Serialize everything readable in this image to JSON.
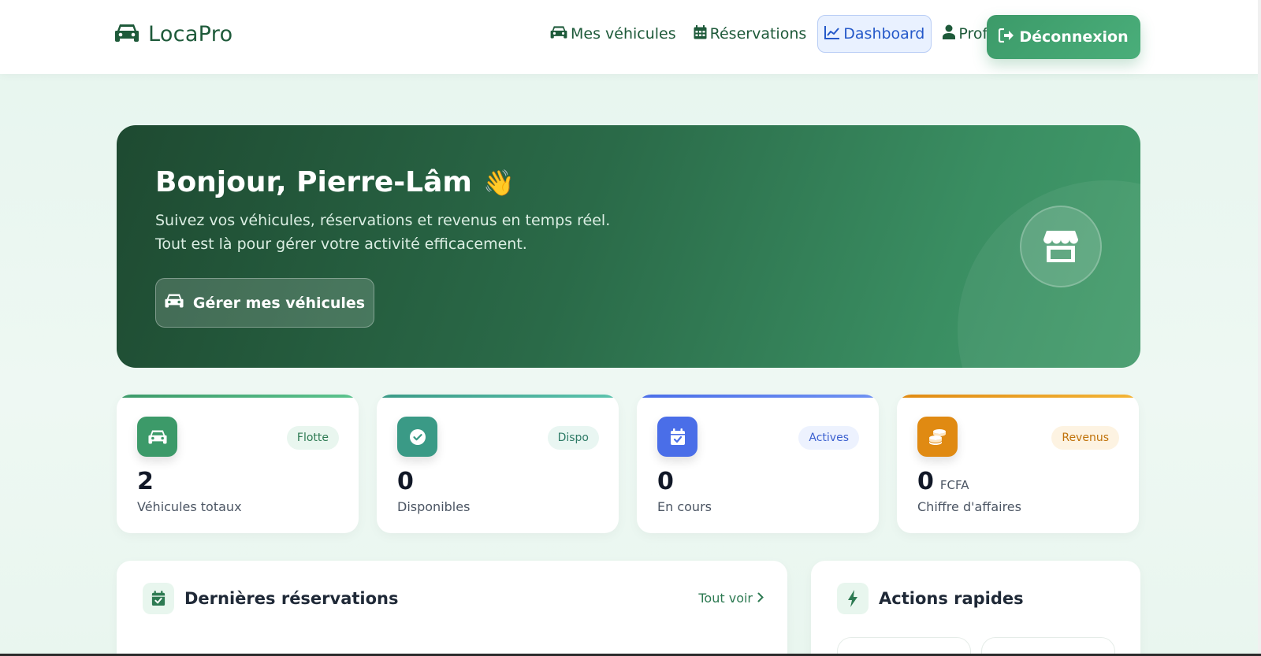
{
  "header": {
    "brand": "LocaPro",
    "nav": [
      {
        "label": "Mes véhicules",
        "icon": "car-icon"
      },
      {
        "label": "Réservations",
        "icon": "calendar-icon"
      },
      {
        "label": "Dashboard",
        "icon": "chart-line-icon",
        "active": true
      },
      {
        "label": "Profil",
        "icon": "user-icon"
      }
    ],
    "logout_label": "Déconnexion"
  },
  "hero": {
    "title": "Bonjour, Pierre-Lâm",
    "wave_emoji": "👋",
    "subtitle": "Suivez vos véhicules, réservations et revenus en temps réel. Tout est là pour gérer votre activité efficacement.",
    "button_label": "Gérer mes véhicules",
    "icon": "store-icon"
  },
  "stats": [
    {
      "tag": "Flotte",
      "value": "2",
      "unit": "",
      "label": "Véhicules totaux",
      "icon": "car-icon",
      "color": "#3c9a69"
    },
    {
      "tag": "Dispo",
      "value": "0",
      "unit": "",
      "label": "Disponibles",
      "icon": "check-circle-icon",
      "color": "#3a9a86"
    },
    {
      "tag": "Actives",
      "value": "0",
      "unit": "",
      "label": "En cours",
      "icon": "calendar-check-icon",
      "color": "#4a6ee8"
    },
    {
      "tag": "Revenus",
      "value": "0",
      "unit": "FCFA",
      "label": "Chiffre d'affaires",
      "icon": "coins-icon",
      "color": "#e08a12"
    }
  ],
  "reservations_panel": {
    "title": "Dernières réservations",
    "see_all": "Tout voir",
    "icon": "calendar-check-icon"
  },
  "quick_actions_panel": {
    "title": "Actions rapides",
    "icon": "bolt-icon"
  }
}
